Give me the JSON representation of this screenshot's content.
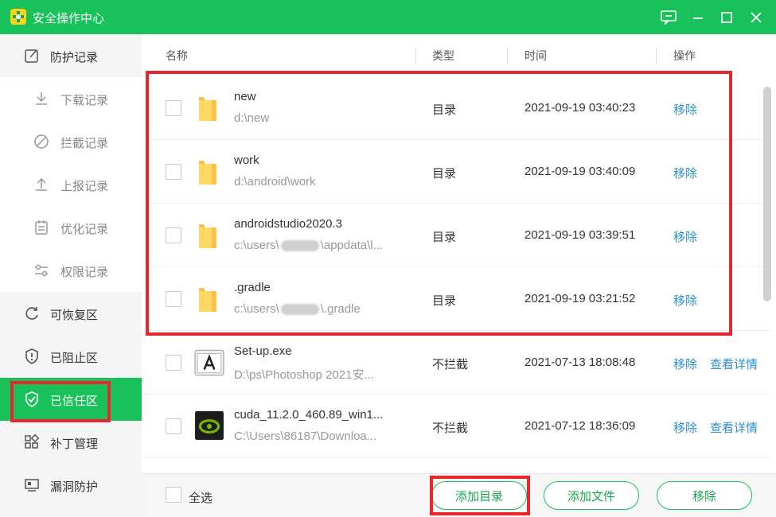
{
  "window": {
    "title": "安全操作中心",
    "accent": "#18c15a",
    "icons": [
      "feedback-icon",
      "minimize-icon",
      "maximize-icon",
      "close-icon"
    ]
  },
  "sidebar": {
    "items": [
      {
        "label": "防护记录",
        "icon": "edit-icon"
      },
      {
        "label": "下载记录",
        "icon": "download-icon"
      },
      {
        "label": "拦截记录",
        "icon": "block-icon"
      },
      {
        "label": "上报记录",
        "icon": "upload-icon"
      },
      {
        "label": "优化记录",
        "icon": "calendar-icon"
      },
      {
        "label": "权限记录",
        "icon": "slider-icon"
      },
      {
        "label": "可恢复区",
        "icon": "restore-icon"
      },
      {
        "label": "已阻止区",
        "icon": "shield-alert-icon"
      },
      {
        "label": "已信任区",
        "icon": "shield-check-icon"
      },
      {
        "label": "补丁管理",
        "icon": "apps-icon"
      },
      {
        "label": "漏洞防护",
        "icon": "monitor-icon"
      }
    ],
    "active": "已信任区"
  },
  "table": {
    "columns": [
      "名称",
      "类型",
      "时间",
      "操作"
    ],
    "rows": [
      {
        "name": "new",
        "path": "d:\\new",
        "type": "目录",
        "time": "2021-09-19 03:40:23",
        "action": "移除",
        "icon": "folder-icon"
      },
      {
        "name": "work",
        "path": "d:\\android\\work",
        "type": "目录",
        "time": "2021-09-19 03:40:09",
        "action": "移除",
        "icon": "folder-icon"
      },
      {
        "name": "androidstudio2020.3",
        "path_prefix": "c:\\users\\",
        "path_suffix": "\\appdata\\l...",
        "type": "目录",
        "time": "2021-09-19 03:39:51",
        "action": "移除",
        "icon": "folder-icon"
      },
      {
        "name": ".gradle",
        "path_prefix": "c:\\users\\",
        "path_suffix": "\\.gradle",
        "type": "目录",
        "time": "2021-09-19 03:21:52",
        "action": "移除",
        "icon": "folder-icon"
      },
      {
        "name": "Set-up.exe",
        "path": "D:\\ps\\Photoshop 2021安...",
        "type": "不拦截",
        "time": "2021-07-13 18:08:48",
        "action": "移除",
        "action2": "查看详情",
        "icon": "adobe-installer-icon"
      },
      {
        "name": "cuda_11.2.0_460.89_win1...",
        "path": "C:\\Users\\86187\\Downloa...",
        "type": "不拦截",
        "time": "2021-07-12 18:36:09",
        "action": "移除",
        "action2": "查看详情",
        "icon": "nvidia-icon"
      }
    ]
  },
  "footer": {
    "select_all": "全选",
    "buttons": [
      "添加目录",
      "添加文件",
      "移除"
    ]
  }
}
